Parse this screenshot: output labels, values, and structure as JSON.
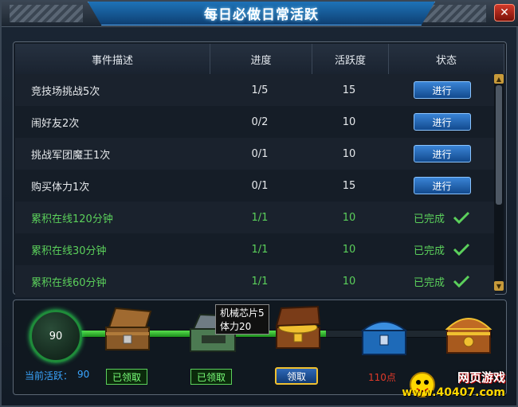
{
  "window": {
    "title": "每日必做日常活跃",
    "close_symbol": "✕"
  },
  "table": {
    "headers": [
      "事件描述",
      "进度",
      "活跃度",
      "状态"
    ],
    "rows": [
      {
        "desc": "竞技场挑战5次",
        "progress": "1/5",
        "points": "15",
        "status": "进行",
        "done": false
      },
      {
        "desc": "闹好友2次",
        "progress": "0/2",
        "points": "10",
        "status": "进行",
        "done": false
      },
      {
        "desc": "挑战军团魔王1次",
        "progress": "0/1",
        "points": "10",
        "status": "进行",
        "done": false
      },
      {
        "desc": "购买体力1次",
        "progress": "0/1",
        "points": "15",
        "status": "进行",
        "done": false
      },
      {
        "desc": "累积在线120分钟",
        "progress": "1/1",
        "points": "10",
        "status": "已完成",
        "done": true
      },
      {
        "desc": "累积在线30分钟",
        "progress": "1/1",
        "points": "10",
        "status": "已完成",
        "done": true
      },
      {
        "desc": "累积在线60分钟",
        "progress": "1/1",
        "points": "10",
        "status": "已完成",
        "done": true
      }
    ]
  },
  "rewards": {
    "current_activity": "90",
    "activity_label": "当前活跃：",
    "activity_value": "90",
    "claimed_label": "已领取",
    "claim_label": "领取",
    "points_110": "110点",
    "tooltip": {
      "line1": "机械芯片5",
      "line2": "体力20"
    },
    "track_progress_fraction": 0.6
  },
  "watermark": {
    "line1": "网页游戏",
    "line2": "www.40407.com"
  },
  "colors": {
    "accent_blue": "#1e73b8",
    "done_green": "#5bd05b",
    "gold": "#f0c030"
  }
}
